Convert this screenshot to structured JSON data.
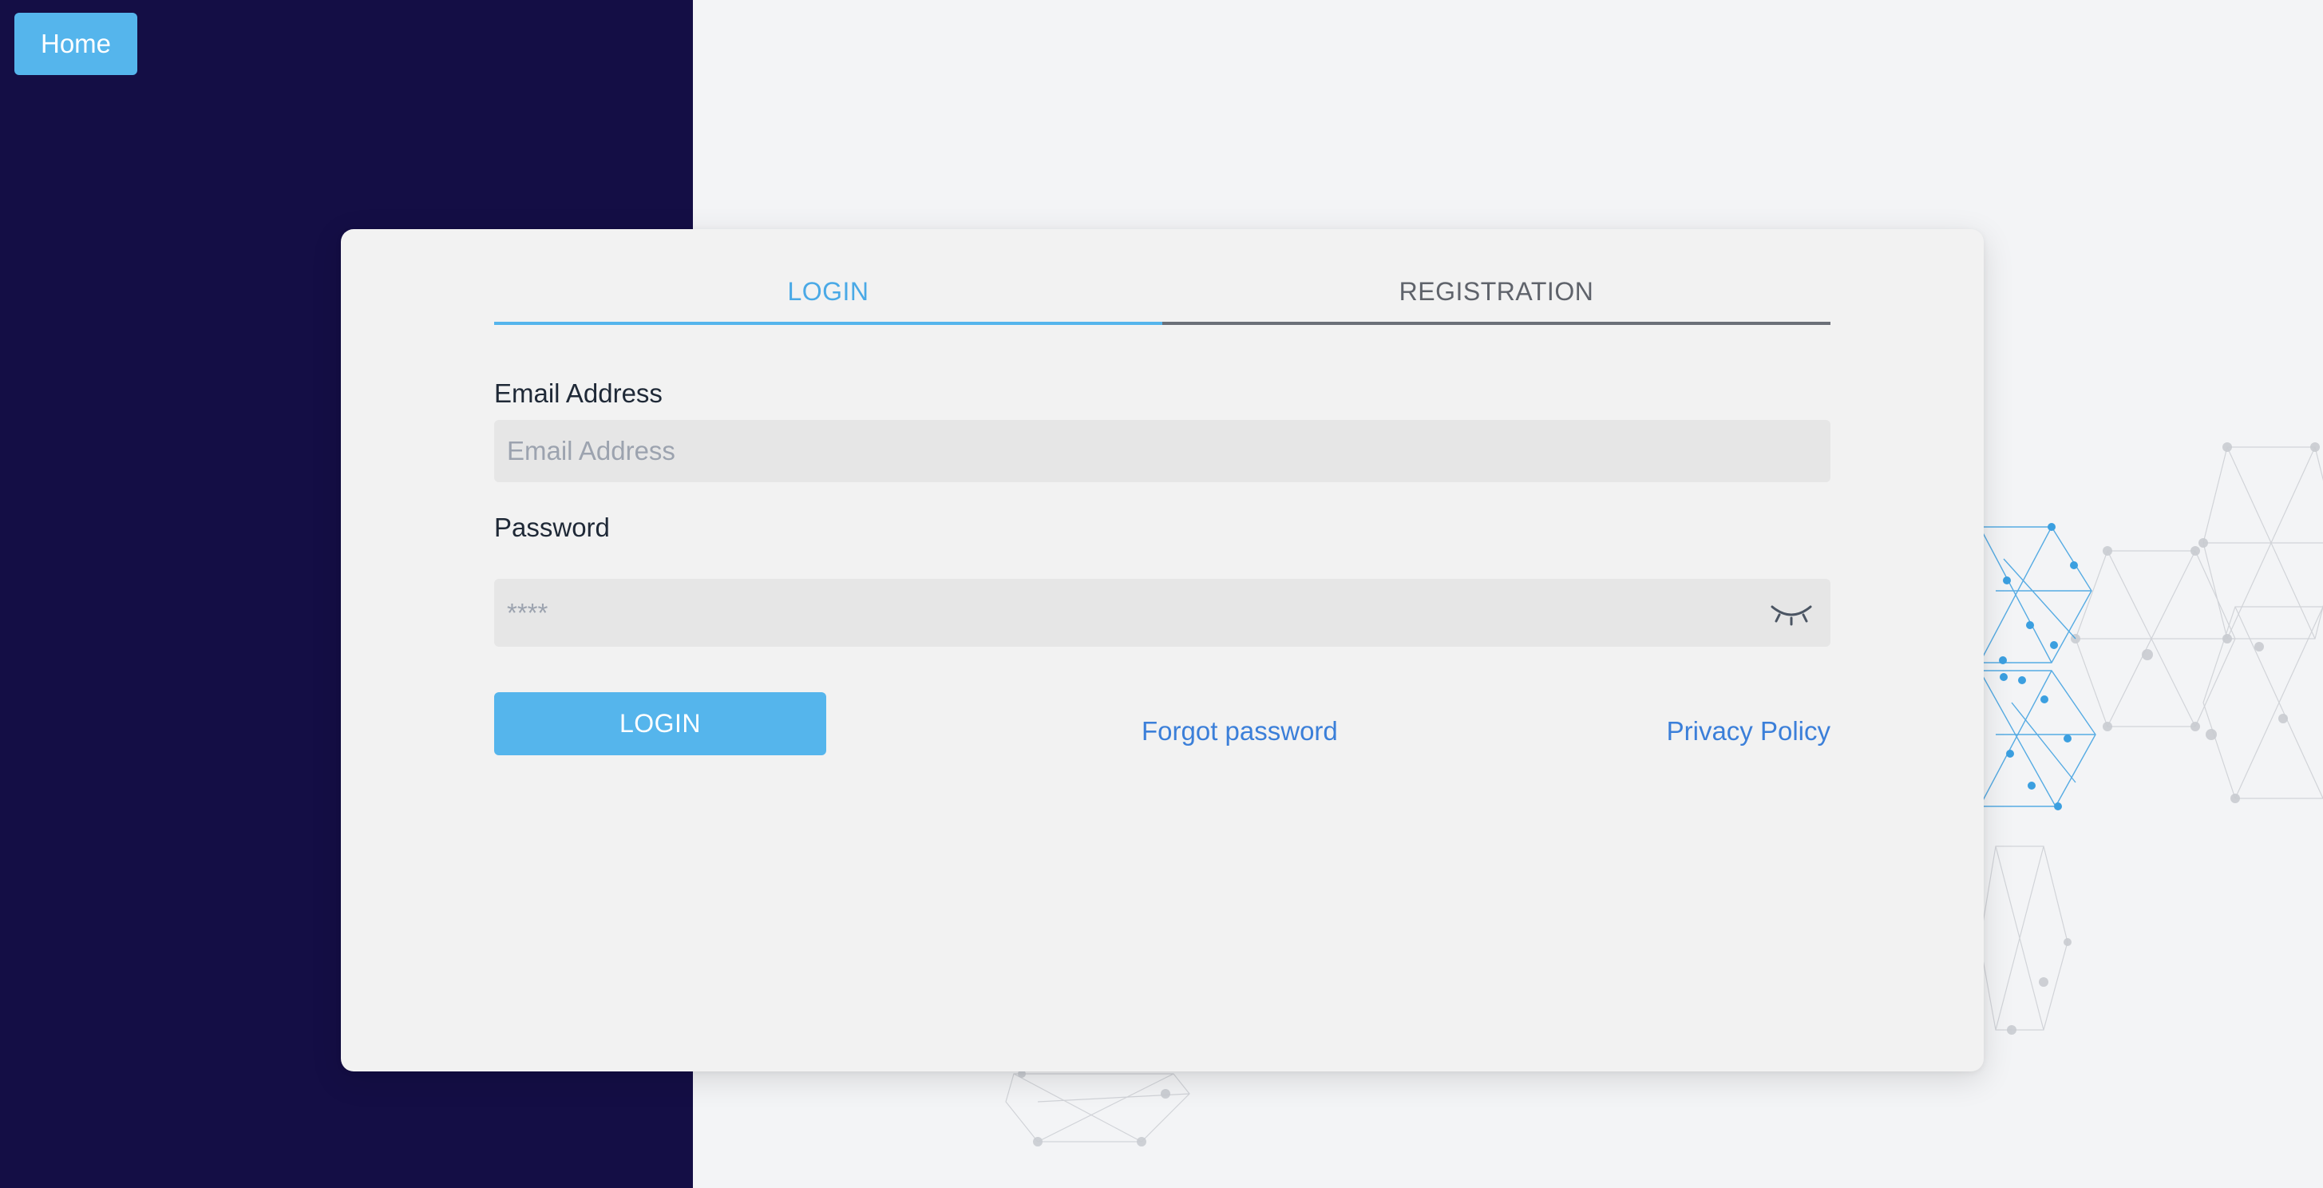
{
  "nav": {
    "home_label": "Home"
  },
  "tabs": [
    {
      "label": "LOGIN",
      "active": true
    },
    {
      "label": "REGISTRATION",
      "active": false
    }
  ],
  "form": {
    "email_label": "Email Address",
    "email_placeholder": "Email Address",
    "email_value": "",
    "password_label": "Password",
    "password_placeholder": "****",
    "password_value": "",
    "password_toggle_icon": "eye-closed-icon",
    "submit_label": "LOGIN",
    "forgot_label": "Forgot password",
    "privacy_label": "Privacy Policy"
  },
  "colors": {
    "sidebar_bg": "#140e45",
    "accent": "#55b5ec",
    "link": "#3b7fd9",
    "card_bg": "#f2f2f2",
    "page_bg": "#f3f4f6"
  }
}
